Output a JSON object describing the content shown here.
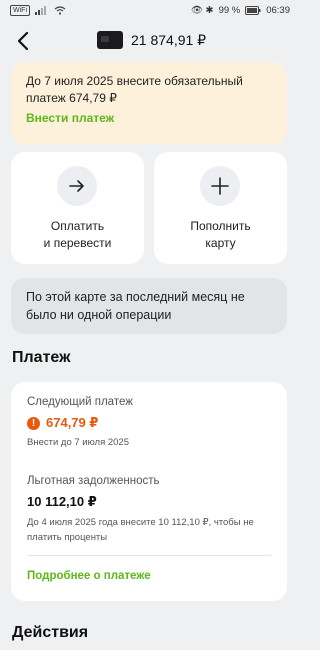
{
  "status_bar": {
    "wifi_badge": "WiFi",
    "right_icons": "👁 ✱",
    "battery": "99 %",
    "time": "06:39"
  },
  "header": {
    "balance": "21 874,91 ₽"
  },
  "notice": {
    "text": "До 7 июля 2025 внесите обязательный платеж 674,79 ₽",
    "link": "Внести платеж"
  },
  "actions": [
    {
      "label": "Оплатить\nи перевести",
      "icon": "arrow-right-icon"
    },
    {
      "label": "Пополнить\nкарту",
      "icon": "plus-icon"
    }
  ],
  "empty_state": {
    "text": "По этой карте за последний месяц не было ни одной операции"
  },
  "payment_section": {
    "title": "Платеж",
    "next_payment_label": "Следующий платеж",
    "next_payment_amount": "674,79 ₽",
    "next_payment_due": "Внести до 7 июля 2025",
    "grace_label": "Льготная задолженность",
    "grace_amount": "10 112,10 ₽",
    "grace_note": "До 4 июля 2025 года внесите 10 112,10 ₽, чтобы не платить проценты",
    "details_link": "Подробнее о платеже"
  },
  "actions_section": {
    "title": "Действия"
  },
  "colors": {
    "accent_green": "#5eb81a",
    "warning_orange": "#e8590c",
    "notice_bg": "#fdf1dc"
  }
}
